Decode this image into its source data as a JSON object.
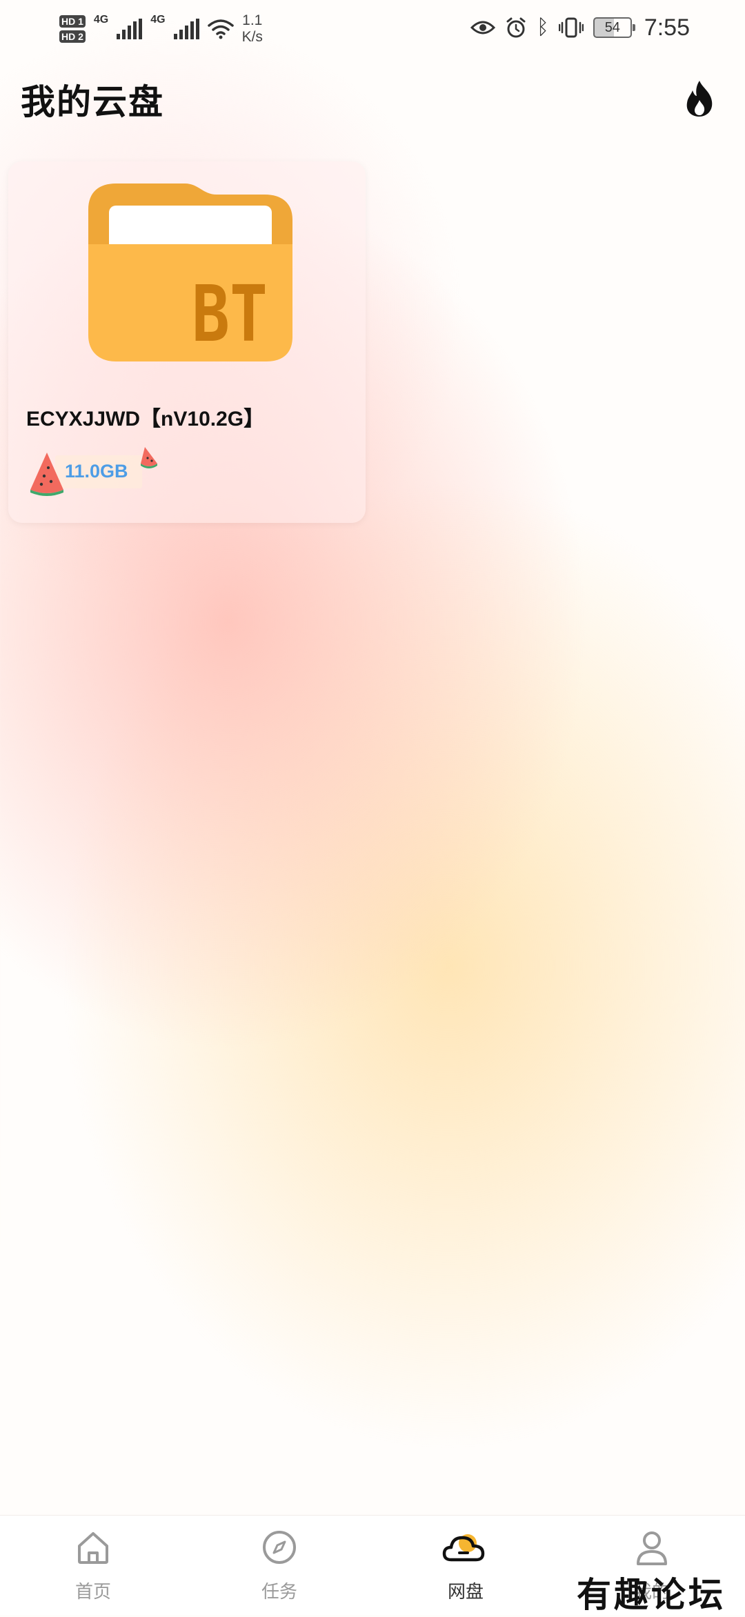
{
  "status_bar": {
    "sim1_tag": "HD 1",
    "sim2_tag": "HD 2",
    "network1": "4G",
    "network2": "4G",
    "speed_value": "1.1",
    "speed_unit": "K/s",
    "battery_level": "54",
    "time": "7:55"
  },
  "header": {
    "title": "我的云盘",
    "hot_icon": "flame-icon"
  },
  "folder": {
    "thumbnail_label": "BT",
    "name": "ECYXJJWD【nV10.2G】",
    "size": "11.0GB"
  },
  "bottom_nav": {
    "items": [
      {
        "label": "首页",
        "icon": "home-icon",
        "active": false
      },
      {
        "label": "任务",
        "icon": "compass-icon",
        "active": false
      },
      {
        "label": "网盘",
        "icon": "cloud-icon",
        "active": true
      },
      {
        "label": "我的",
        "icon": "user-icon",
        "active": false
      }
    ]
  },
  "watermark": {
    "text": "有趣论坛"
  },
  "colors": {
    "folder_body": "#FDB94A",
    "folder_tab": "#EFA738",
    "folder_label": "#C97A0E",
    "size_text": "#4D9DE6",
    "cloud_accent": "#F5B531"
  }
}
